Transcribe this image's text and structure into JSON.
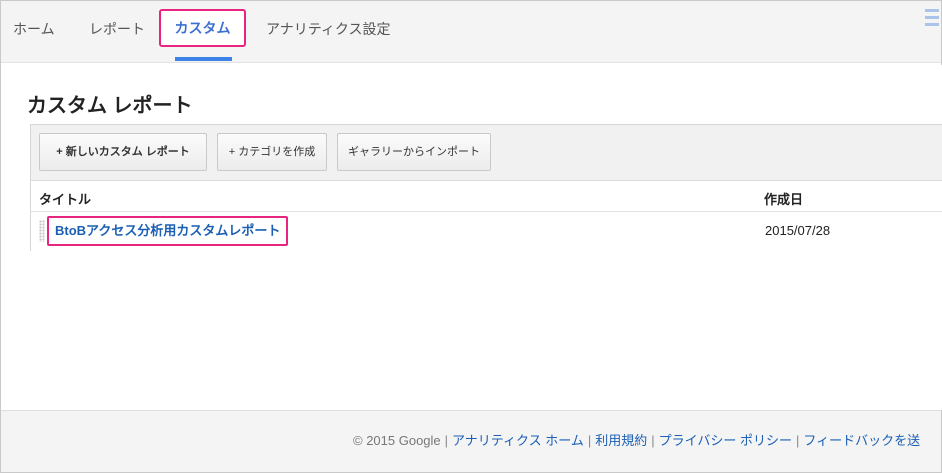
{
  "nav": {
    "tabs": [
      {
        "label": "ホーム"
      },
      {
        "label": "レポート"
      },
      {
        "label": "カスタム"
      },
      {
        "label": "アナリティクス設定"
      }
    ]
  },
  "page": {
    "title": "カスタム レポート"
  },
  "toolbar": {
    "new_report_label": "+ 新しいカスタム レポート",
    "new_category_label": "+ カテゴリを作成",
    "import_label": "ギャラリーからインポート"
  },
  "table": {
    "columns": [
      "タイトル",
      "作成日"
    ],
    "rows": [
      {
        "title": "BtoBアクセス分析用カスタムレポート",
        "date": "2015/07/28"
      }
    ]
  },
  "footer": {
    "copyright": "© 2015 Google",
    "links": [
      "アナリティクス ホーム",
      "利用規約",
      "プライバシー ポリシー",
      "フィードバックを送"
    ]
  },
  "colors": {
    "highlight": "#e7247f",
    "link": "#1a5fb4",
    "active_tab_underline": "#3d82e6"
  }
}
